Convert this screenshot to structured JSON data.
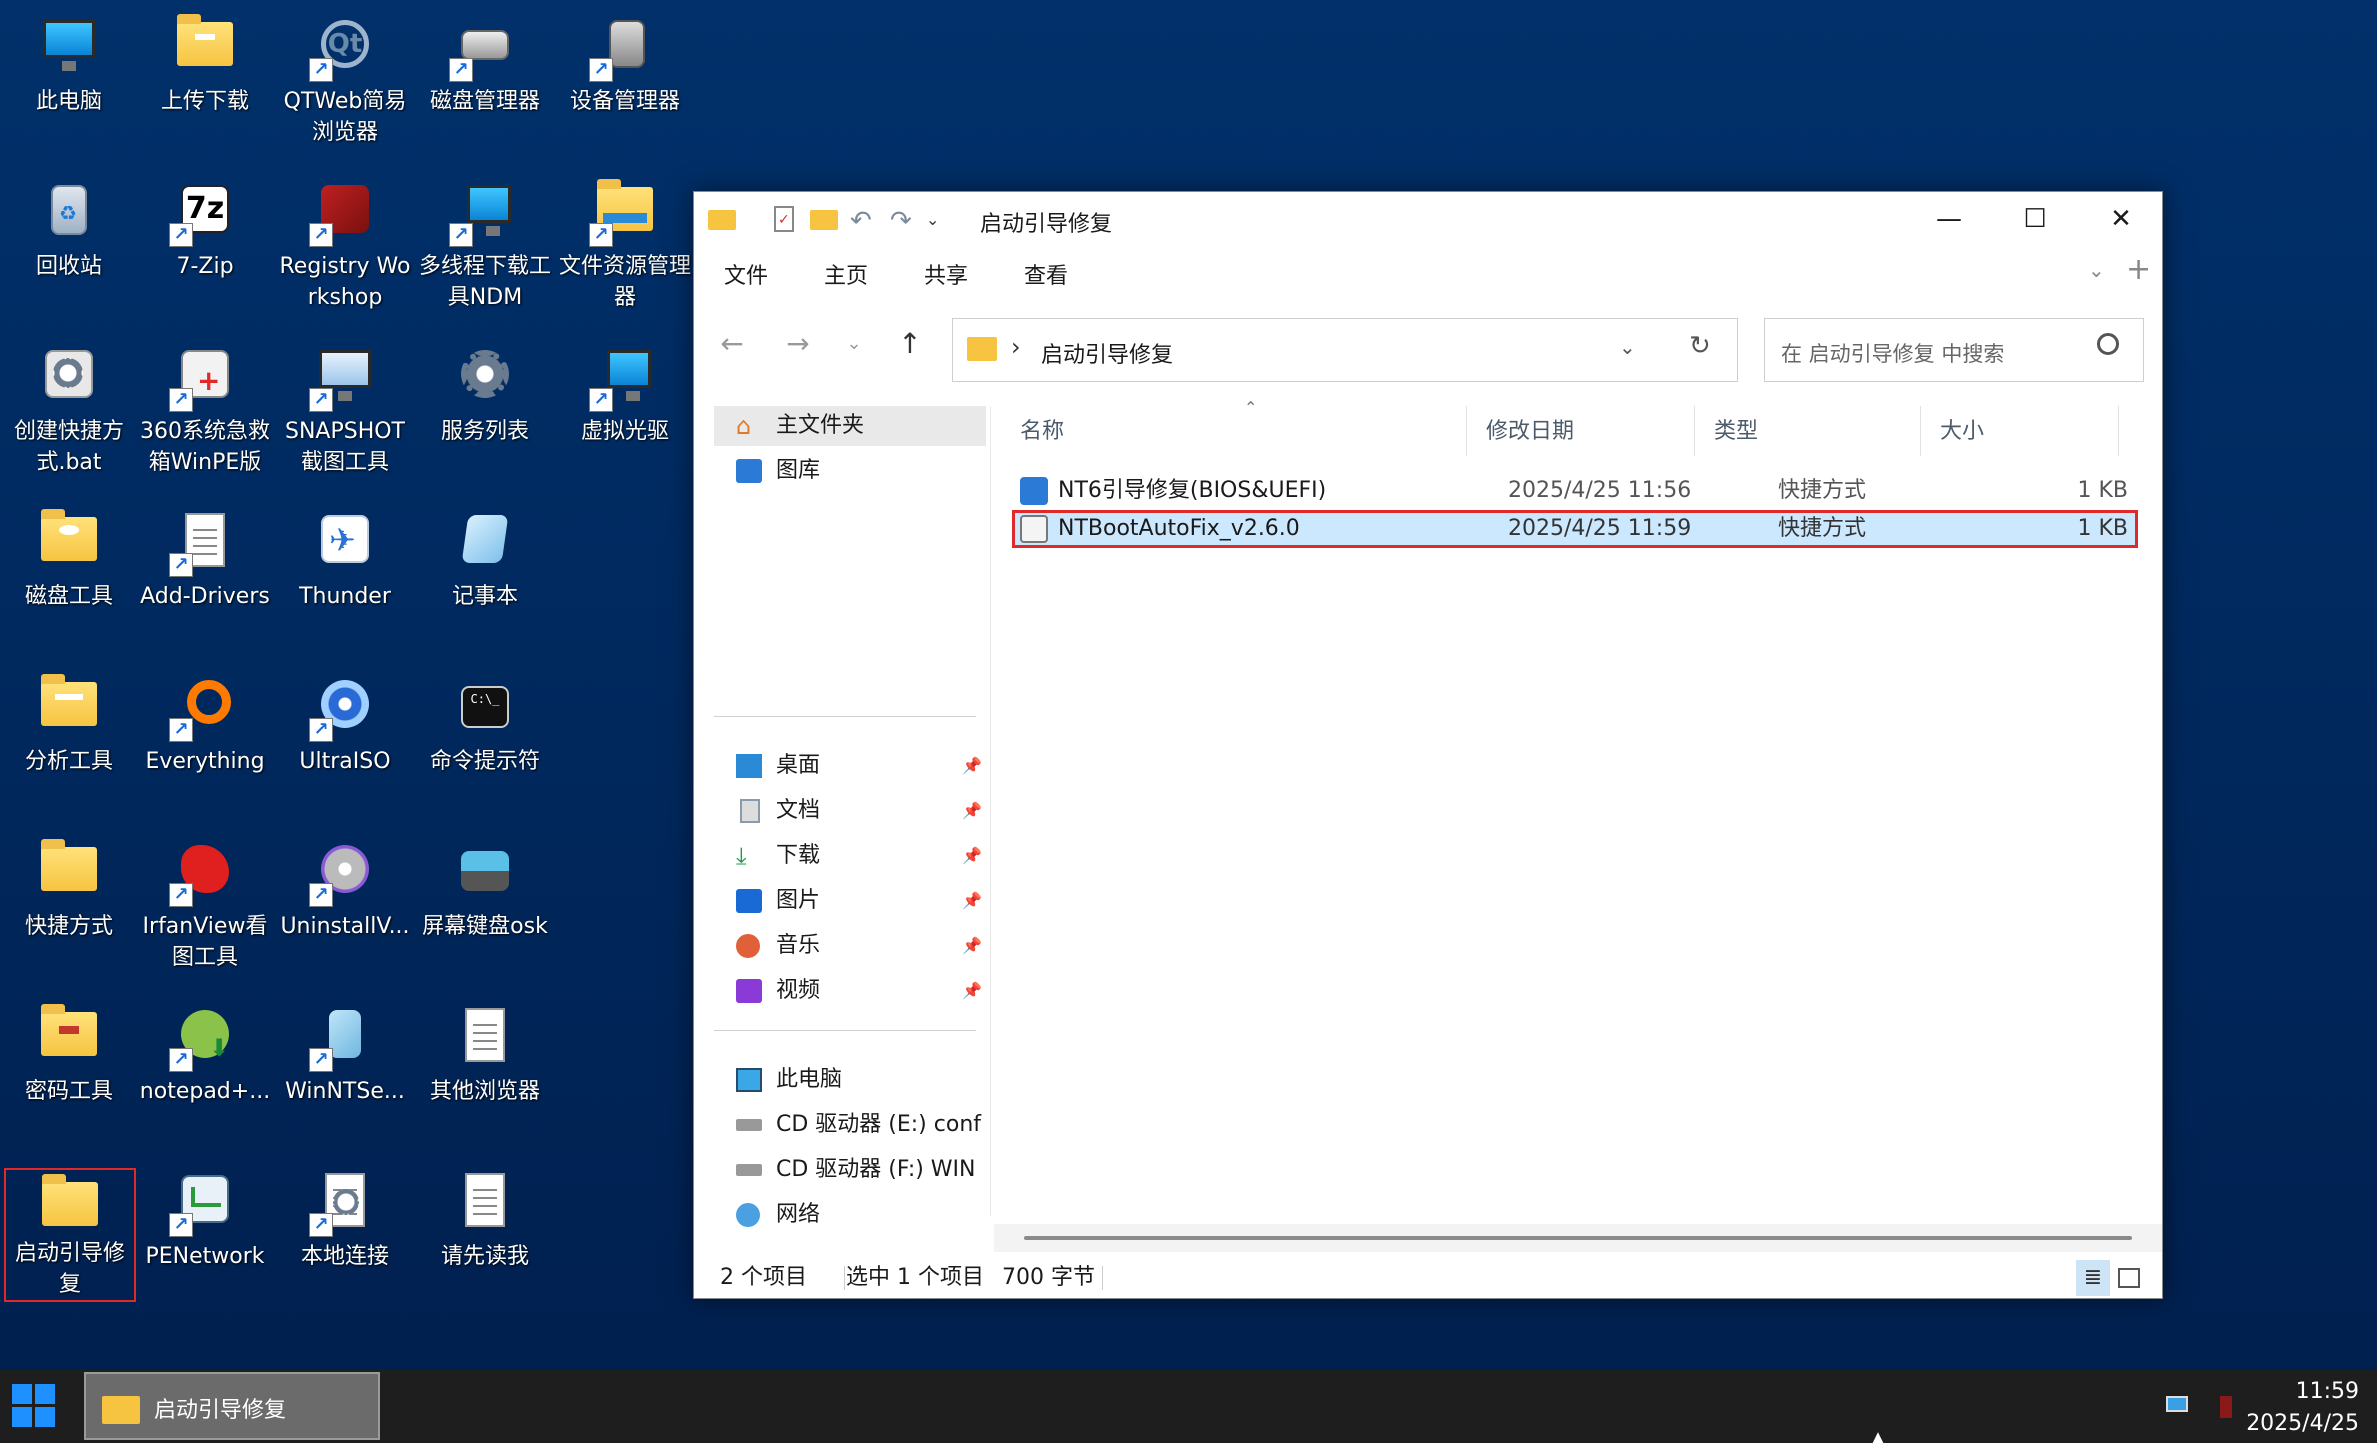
{
  "desktop": {
    "icons": [
      {
        "label": "此电脑",
        "icon": "computer-icon"
      },
      {
        "label": "上传下载",
        "icon": "folder-icon"
      },
      {
        "label": "QTWeb简易浏览器",
        "icon": "qtweb-icon"
      },
      {
        "label": "磁盘管理器",
        "icon": "disk-manager-icon"
      },
      {
        "label": "设备管理器",
        "icon": "device-manager-icon"
      },
      {
        "label": "回收站",
        "icon": "recycle-bin-icon"
      },
      {
        "label": "7-Zip",
        "icon": "7zip-icon"
      },
      {
        "label": "Registry Workshop",
        "icon": "registry-icon"
      },
      {
        "label": "多线程下载工具NDM",
        "icon": "ndm-icon"
      },
      {
        "label": "文件资源管理器",
        "icon": "file-explorer-icon"
      },
      {
        "label": "创建快捷方式.bat",
        "icon": "bat-icon"
      },
      {
        "label": "360系统急救箱WinPE版",
        "icon": "first-aid-icon"
      },
      {
        "label": "SNAPSHOT截图工具",
        "icon": "snapshot-icon"
      },
      {
        "label": "服务列表",
        "icon": "services-icon"
      },
      {
        "label": "虚拟光驱",
        "icon": "virtual-drive-icon"
      },
      {
        "label": "磁盘工具",
        "icon": "folder-icon"
      },
      {
        "label": "Add-Drivers",
        "icon": "document-icon"
      },
      {
        "label": "Thunder",
        "icon": "thunder-icon"
      },
      {
        "label": "记事本",
        "icon": "notepad-icon"
      },
      {
        "label": "分析工具",
        "icon": "folder-icon"
      },
      {
        "label": "Everything",
        "icon": "everything-icon"
      },
      {
        "label": "UltraISO",
        "icon": "ultraiso-icon"
      },
      {
        "label": "命令提示符",
        "icon": "cmd-icon"
      },
      {
        "label": "快捷方式",
        "icon": "folder-icon"
      },
      {
        "label": "IrfanView看图工具",
        "icon": "irfanview-icon"
      },
      {
        "label": "UninstallV...",
        "icon": "uninstall-icon"
      },
      {
        "label": "屏幕键盘osk",
        "icon": "keyboard-icon"
      },
      {
        "label": "密码工具",
        "icon": "folder-icon"
      },
      {
        "label": "notepad+...",
        "icon": "notepadpp-icon"
      },
      {
        "label": "WinNTSe...",
        "icon": "winntsetup-icon"
      },
      {
        "label": "其他浏览器",
        "icon": "document-icon"
      },
      {
        "label": "启动引导修复",
        "icon": "folder-icon"
      },
      {
        "label": "PENetwork",
        "icon": "penetwork-icon"
      },
      {
        "label": "本地连接",
        "icon": "network-connection-icon"
      },
      {
        "label": "请先读我",
        "icon": "document-icon"
      }
    ]
  },
  "explorer": {
    "title": "启动引导修复",
    "window_buttons": {
      "minimize": "—",
      "maximize": "☐",
      "close": "✕"
    },
    "ribbon_tabs": [
      "文件",
      "主页",
      "共享",
      "查看"
    ],
    "address": {
      "path": "启动引导修复",
      "separator": "›"
    },
    "search": {
      "placeholder": "在 启动引导修复 中搜索"
    },
    "nav": {
      "top": [
        {
          "label": "主文件夹",
          "icon": "home-icon"
        },
        {
          "label": "图库",
          "icon": "gallery-icon"
        }
      ],
      "quick": [
        {
          "label": "桌面",
          "icon": "desktop-icon"
        },
        {
          "label": "文档",
          "icon": "documents-icon"
        },
        {
          "label": "下载",
          "icon": "download-icon"
        },
        {
          "label": "图片",
          "icon": "pictures-icon"
        },
        {
          "label": "音乐",
          "icon": "music-icon"
        },
        {
          "label": "视频",
          "icon": "videos-icon"
        }
      ],
      "devices": [
        {
          "label": "此电脑",
          "icon": "computer-icon"
        },
        {
          "label": "CD 驱动器 (E:) conf",
          "icon": "cd-drive-icon"
        },
        {
          "label": "CD 驱动器 (F:) WIN",
          "icon": "cd-drive-icon"
        },
        {
          "label": "网络",
          "icon": "network-icon"
        }
      ]
    },
    "columns": {
      "name": "名称",
      "date": "修改日期",
      "type": "类型",
      "size": "大小"
    },
    "files": [
      {
        "name": "NT6引导修复(BIOS&UEFI)",
        "date": "2025/4/25 11:56",
        "type": "快捷方式",
        "size": "1 KB"
      },
      {
        "name": "NTBootAutoFix_v2.6.0",
        "date": "2025/4/25 11:59",
        "type": "快捷方式",
        "size": "1 KB"
      }
    ],
    "status": {
      "count": "2 个项目",
      "selected": "选中 1 个项目",
      "bytes": "700 字节"
    }
  },
  "taskbar": {
    "task_label": "启动引导修复",
    "time": "11:59",
    "date": "2025/4/25"
  }
}
